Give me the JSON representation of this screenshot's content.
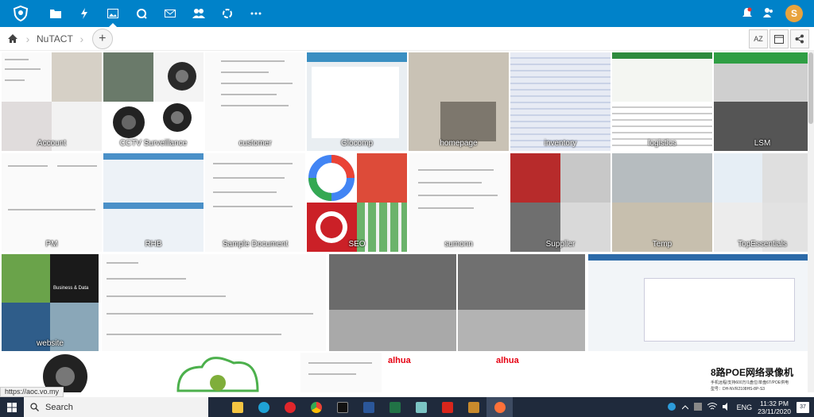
{
  "topbar": {
    "apps": [
      "files-icon",
      "activity-icon",
      "gallery-icon",
      "talk-icon",
      "mail-icon",
      "contacts-icon",
      "circles-icon",
      "more-icon"
    ],
    "avatar_initial": "S",
    "color": "#0082c9"
  },
  "breadcrumb": {
    "folder": "NuTACT",
    "add_label": "+"
  },
  "views": {
    "sort_label": "AZ"
  },
  "albums": [
    {
      "label": "Account"
    },
    {
      "label": "CCTV Surveillance"
    },
    {
      "label": "customer"
    },
    {
      "label": "Glocomp"
    },
    {
      "label": "homepage"
    },
    {
      "label": "inventory"
    },
    {
      "label": "logistics"
    },
    {
      "label": "LSM"
    },
    {
      "label": "PM"
    },
    {
      "label": "RHB"
    },
    {
      "label": "Sample Document"
    },
    {
      "label": "SEO"
    },
    {
      "label": "sumonn"
    },
    {
      "label": "Supplier"
    },
    {
      "label": "Temp"
    },
    {
      "label": "TopEssentials"
    },
    {
      "label": "website"
    }
  ],
  "extra_text": {
    "business": "Business & Data",
    "alhua": "alhua",
    "poe_title": "8路POE网络录像机",
    "poe_sub": "手机远程/支持600万/1盘位/单盘6T/POE供电",
    "poe_model": "型号：DH-NVR2108HS-8P-S3"
  },
  "status_url": "https://aoc.vo.my",
  "taskbar": {
    "search_placeholder": "Search",
    "lang": "ENG",
    "time": "11:32 PM",
    "date": "23/11/2020",
    "notif_count": "37"
  }
}
